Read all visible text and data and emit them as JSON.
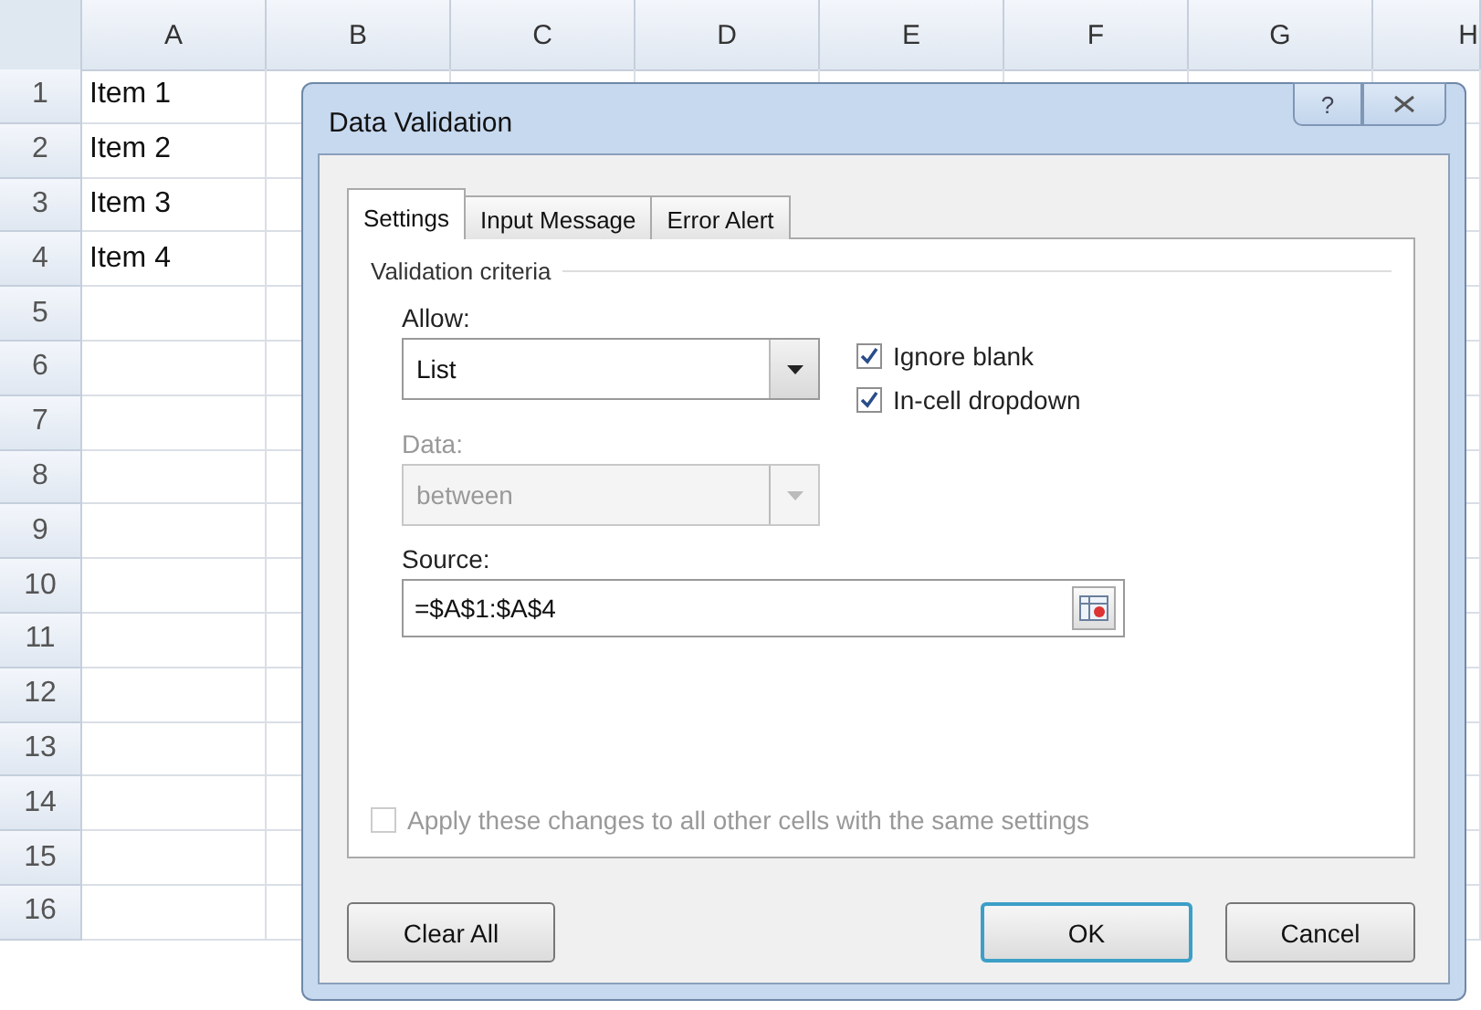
{
  "sheet": {
    "columns": [
      "A",
      "B",
      "C",
      "D",
      "E",
      "F",
      "G",
      "H"
    ],
    "rows": [
      {
        "number": "1",
        "cell_a": "Item 1"
      },
      {
        "number": "2",
        "cell_a": "Item 2"
      },
      {
        "number": "3",
        "cell_a": "Item 3"
      },
      {
        "number": "4",
        "cell_a": "Item 4"
      },
      {
        "number": "5"
      },
      {
        "number": "6"
      },
      {
        "number": "7"
      },
      {
        "number": "8"
      },
      {
        "number": "9"
      },
      {
        "number": "10"
      },
      {
        "number": "11"
      },
      {
        "number": "12"
      },
      {
        "number": "13"
      },
      {
        "number": "14"
      },
      {
        "number": "15"
      },
      {
        "number": "16"
      }
    ]
  },
  "dialog": {
    "title": "Data Validation",
    "help_glyph": "?",
    "tabs": [
      {
        "label": "Settings",
        "selected": true
      },
      {
        "label": "Input Message",
        "selected": false
      },
      {
        "label": "Error Alert",
        "selected": false
      }
    ],
    "group_title": "Validation criteria",
    "allow": {
      "label": "Allow:",
      "value": "List",
      "disabled": false
    },
    "data": {
      "label": "Data:",
      "value": "between",
      "disabled": true
    },
    "options": [
      {
        "label": "Ignore blank",
        "checked": true
      },
      {
        "label": "In-cell dropdown",
        "checked": true
      }
    ],
    "source": {
      "label": "Source:",
      "value": "=$A$1:$A$4"
    },
    "apply_all": {
      "label": "Apply these changes to all other cells with the same settings",
      "checked": false,
      "disabled": true
    },
    "buttons": [
      {
        "label": "Clear All",
        "default": false
      },
      {
        "label": "OK",
        "default": true
      },
      {
        "label": "Cancel",
        "default": false
      }
    ]
  }
}
